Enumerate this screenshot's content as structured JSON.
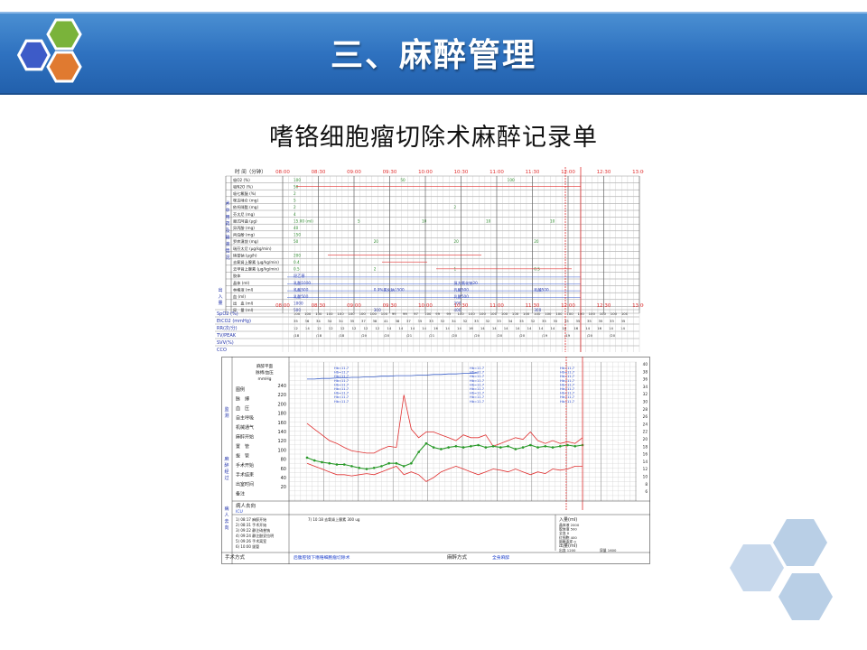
{
  "slide": {
    "title": "三、麻醉管理",
    "subtitle": "嗜铬细胞瘤切除术麻醉记录单"
  },
  "record_top": {
    "time_header_label": "时 间（分钟）",
    "times": [
      "08:00",
      "08:30",
      "09:00",
      "09:30",
      "10:00",
      "10:30",
      "11:00",
      "11:30",
      "12:00",
      "12:30",
      "13:00"
    ],
    "drug_rows": [
      {
        "label": "吸O2 (%)",
        "values": [
          "100",
          "50",
          "100"
        ]
      },
      {
        "label": "吸N2O (%)",
        "values": [
          "50"
        ]
      },
      {
        "label": "吸七氟醚 (%)",
        "values": [
          "2"
        ]
      },
      {
        "label": "咪达唑仑 (mg)",
        "values": [
          "5"
        ]
      },
      {
        "label": "依托咪酯 (mg)",
        "values": [
          "2",
          "2"
        ]
      },
      {
        "label": "芬太尼 (mg)",
        "values": [
          "4"
        ]
      },
      {
        "label": "顺式阿曲 (μg)",
        "values": [
          "15.00 (ml)",
          "5",
          "10",
          "10",
          "10"
        ]
      },
      {
        "label": "异丙酚 (mg)",
        "values": [
          "40"
        ]
      },
      {
        "label": "丙泊酚 (mg)",
        "values": [
          "150"
        ]
      },
      {
        "label": "罗库溴铵 (mg)",
        "values": [
          "50",
          "20",
          "20",
          "20"
        ]
      },
      {
        "label": "瑞芬太尼 (μg/kg/min)",
        "values": []
      },
      {
        "label": "硝普钠 (μg/h)",
        "values": [
          "200"
        ]
      },
      {
        "label": "去氧肾上腺素 (μg/kg/min)",
        "values": [
          "0.4"
        ]
      },
      {
        "label": "去甲肾上腺素 (μg/kg/min)",
        "values": [
          "0.5",
          "2",
          "1",
          "0.5"
        ]
      }
    ],
    "fluid_rows": [
      {
        "label": "胶体",
        "values": [
          "羟乙基"
        ]
      },
      {
        "label": "晶体 (ml)",
        "values": [
          "乳酸1000",
          "复方氯化钠20"
        ]
      },
      {
        "label": "林格液 (ml)",
        "values": [
          "乳酸500",
          "0.9%氯化钠1500",
          "乳酸500",
          "乳酸500"
        ]
      },
      {
        "label": "血 (ml)",
        "values": [
          "乳酸500",
          "乳酸500"
        ]
      }
    ],
    "side_label": "术中用药及输液情况",
    "out_rows": [
      {
        "label": "出　血 (ml)",
        "values": [
          "1000",
          "200"
        ]
      },
      {
        "label": "尿　量 (ml)",
        "values": [
          "500",
          "300",
          "400",
          "300"
        ]
      }
    ],
    "side_label2": "出入量",
    "vital_rows": [
      {
        "label": "SpO2 (%)",
        "values": [
          "100",
          "100",
          "100",
          "100",
          "100",
          "100",
          "100",
          "100",
          "100",
          "99",
          "99",
          "97",
          "100",
          "99",
          "99",
          "100",
          "100",
          "100",
          "100",
          "100",
          "100",
          "100",
          "100",
          "100",
          "100",
          "100",
          "100",
          "100",
          "100",
          "100",
          "100"
        ]
      },
      {
        "label": "EtCO2 (mmHg)",
        "values": [
          "35",
          "36",
          "34",
          "34",
          "34",
          "35",
          "37",
          "38",
          "41",
          "38",
          "37",
          "35",
          "33",
          "32",
          "34",
          "32",
          "33",
          "32",
          "33",
          "34",
          "35",
          "32",
          "35",
          "35",
          "35",
          "35",
          "35",
          "35",
          "33",
          "35"
        ]
      },
      {
        "label": "RR(次/分)",
        "values": [
          "12",
          "14",
          "12",
          "12",
          "12",
          "12",
          "12",
          "12",
          "14",
          "14",
          "14",
          "14",
          "16",
          "14",
          "14",
          "16",
          "14",
          "14",
          "14",
          "14",
          "14",
          "14",
          "14",
          "16",
          "16",
          "14",
          "16",
          "14",
          "14"
        ]
      },
      {
        "label": "TV/PEAK",
        "values": [
          "/18",
          "/18",
          "/18",
          "/20",
          "/20",
          "/21",
          "/21",
          "/20",
          "/20",
          "/20",
          "/20",
          "/19",
          "/19",
          "/20",
          "/20"
        ]
      },
      {
        "label": "SVV(%)",
        "values": []
      },
      {
        "label": "CCO",
        "values": []
      }
    ]
  },
  "record_bottom": {
    "legend_title": "麻醉平面\n脉搏/血压\nmmHg",
    "legend_items": [
      "图例",
      "脉　搏",
      "血　压",
      "自主呼吸",
      "机械通气",
      "麻醉开始",
      "置　管",
      "拔　管",
      "手术开始",
      "手术结束",
      "出室时间",
      "备注"
    ],
    "y_left": [
      "240",
      "220",
      "200",
      "180",
      "160",
      "140",
      "120",
      "100",
      "80",
      "60",
      "40",
      "20"
    ],
    "y_right": [
      "40",
      "38",
      "36",
      "34",
      "32",
      "30",
      "28",
      "26",
      "24",
      "22",
      "20",
      "18",
      "16",
      "14",
      "12",
      "10",
      "8",
      "6"
    ],
    "chart_data": [
      {
        "type": "line",
        "x_points": 38,
        "ylim": [
          0,
          260
        ],
        "series": [
          {
            "color": "#e03030",
            "values": [
              160,
              150,
              140,
              130,
              125,
              118,
              112,
              110,
              108,
              108,
              115,
              120,
              118,
              210,
              150,
              135,
              145,
              145,
              140,
              135,
              130,
              140,
              135,
              135,
              140,
              120,
              125,
              130,
              135,
              132,
              145,
              130,
              125,
              130,
              125,
              128,
              125,
              135
            ]
          },
          {
            "color": "#e03030",
            "values": [
              90,
              85,
              80,
              75,
              70,
              70,
              68,
              70,
              72,
              70,
              75,
              80,
              85,
              70,
              75,
              70,
              58,
              65,
              75,
              80,
              85,
              80,
              75,
              70,
              75,
              80,
              78,
              75,
              80,
              75,
              70,
              75,
              72,
              80,
              78,
              80,
              85,
              85
            ]
          },
          {
            "color": "#2a9a2a",
            "values": [
              100,
              95,
              92,
              90,
              88,
              88,
              85,
              82,
              80,
              82,
              85,
              90,
              90,
              85,
              90,
              110,
              125,
              118,
              115,
              118,
              120,
              118,
              120,
              122,
              118,
              120,
              118,
              120,
              115,
              118,
              122,
              118,
              120,
              118,
              120,
              122,
              120,
              122
            ]
          },
          {
            "color": "#3a5fc8",
            "values": [
              238,
              238,
              239,
              239,
              240,
              240,
              241,
              241,
              242,
              242,
              243,
              243,
              244,
              244,
              244,
              245,
              245,
              246,
              246,
              247,
              247,
              248,
              248,
              249
            ]
          }
        ]
      }
    ],
    "section_labels": [
      "监测",
      "麻醉经过",
      "病人去向"
    ],
    "event_notes": [
      "1) 08:17 麻醉开始",
      "2) 08:31 手术开始",
      "3) 09:22 静注硝普钠",
      "4) 09:24 静注酚妥拉明",
      "5) 09:26 手术离室",
      "6) 10:00 拔管",
      "7) 10:18 去氧肾上腺素 300 ug"
    ],
    "intake_title": "入量(ml)",
    "intake_items": [
      "晶体液 2000",
      "胶体液 500",
      "全血 0",
      "红细胞 400",
      "新鲜血浆 0"
    ],
    "output_title": "出量(ml)",
    "output_items": [
      "出血 1200",
      "尿量 1600"
    ],
    "surgery_label": "手术方式",
    "surgery_value": "后腹腔镜下嗜铬细胞瘤切除术",
    "anesthesia_label": "麻醉方式",
    "anesthesia_value": "全身麻醉",
    "destination_label": "病人去向",
    "destination_value": "ICU"
  },
  "colors": {
    "header_blue": "#2f72c0",
    "hex_blue": "#3d5bc8",
    "hex_green": "#7ab33a",
    "hex_orange": "#e07a30",
    "corner_hex": "#b9cfe6",
    "time_red": "#e03030"
  }
}
